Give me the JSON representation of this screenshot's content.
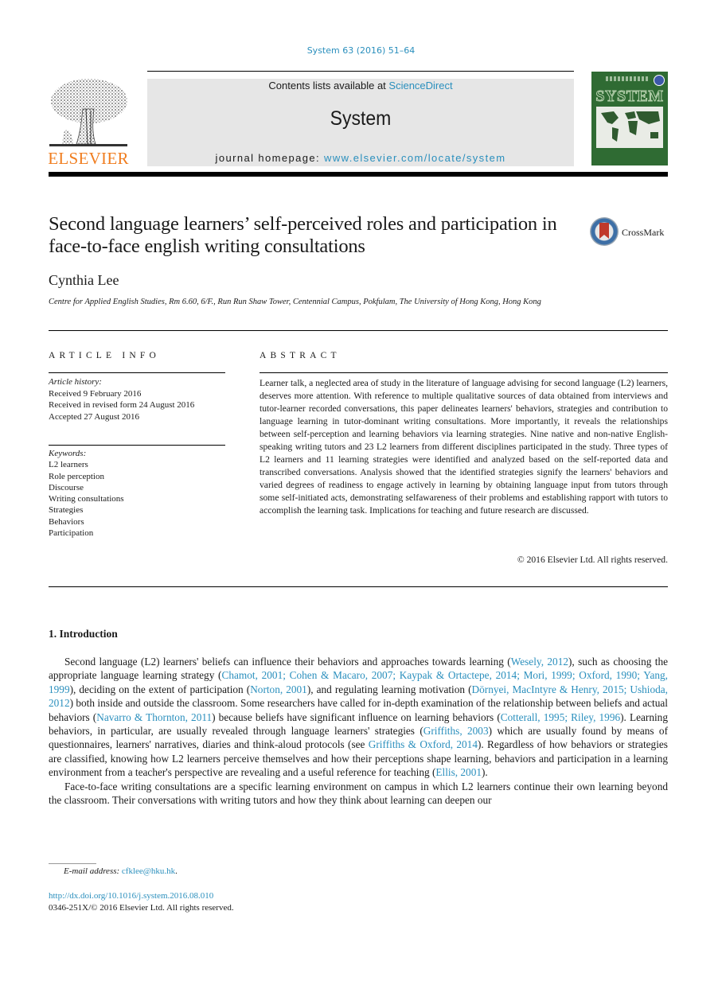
{
  "header": {
    "citation": "System 63 (2016) 51–64",
    "publisher_logo_text": "ELSEVIER",
    "contents_prefix": "Contents lists available at ",
    "contents_link": "ScienceDirect",
    "journal_name": "System",
    "homepage_prefix": "journal homepage: ",
    "homepage_link": "www.elsevier.com/locate/system",
    "cover_title": "SYSTEM",
    "brand_orange": "#f07d1f",
    "link_color": "#2a8fbd",
    "cover_green": "#2f6b33"
  },
  "article": {
    "title": "Second language learners’ self-perceived roles and participation in face-to-face english writing consultations",
    "crossmark_label": "CrossMark",
    "author": "Cynthia Lee",
    "affiliation": "Centre for Applied English Studies, Rm 6.60, 6/F., Run Run Shaw Tower, Centennial Campus, Pokfulam, The University of Hong Kong, Hong Kong"
  },
  "article_info": {
    "heading": "ARTICLE INFO",
    "history_label": "Article history:",
    "history": [
      "Received 9 February 2016",
      "Received in revised form 24 August 2016",
      "Accepted 27 August 2016"
    ],
    "keywords_label": "Keywords:",
    "keywords": [
      "L2 learners",
      "Role perception",
      "Discourse",
      "Writing consultations",
      "Strategies",
      "Behaviors",
      "Participation"
    ]
  },
  "abstract": {
    "heading": "ABSTRACT",
    "text": "Learner talk, a neglected area of study in the literature of language advising for second language (L2) learners, deserves more attention. With reference to multiple qualitative sources of data obtained from interviews and tutor-learner recorded conversations, this paper delineates learners' behaviors, strategies and contribution to language learning in tutor-dominant writing consultations. More importantly, it reveals the relationships between self-perception and learning behaviors via learning strategies. Nine native and non-native English-speaking writing tutors and 23 L2 learners from different disciplines participated in the study. Three types of L2 learners and 11 learning strategies were identified and analyzed based on the self-reported data and transcribed conversations. Analysis showed that the identified strategies signify the learners' behaviors and varied degrees of readiness to engage actively in learning by obtaining language input from tutors through some self-initiated acts, demonstrating selfawareness of their problems and establishing rapport with tutors to accomplish the learning task. Implications for teaching and future research are discussed.",
    "copyright": "© 2016 Elsevier Ltd. All rights reserved."
  },
  "intro": {
    "heading": "1.  Introduction",
    "p1": [
      {
        "t": "Second language (L2) learners' beliefs can influence their behaviors and approaches towards learning ("
      },
      {
        "t": "Wesely, 2012",
        "link": true
      },
      {
        "t": "), such as choosing the appropriate language learning strategy ("
      },
      {
        "t": "Chamot, 2001; Cohen & Macaro, 2007; Kaypak & Ortactepe, 2014; Mori, 1999; Oxford, 1990; Yang, 1999",
        "link": true
      },
      {
        "t": "), deciding on the extent of participation ("
      },
      {
        "t": "Norton, 2001",
        "link": true
      },
      {
        "t": "), and regulating learning motivation ("
      },
      {
        "t": "Dörnyei, MacIntyre & Henry, 2015; Ushioda, 2012",
        "link": true
      },
      {
        "t": ") both inside and outside the classroom. Some researchers have called for in-depth examination of the relationship between beliefs and actual behaviors ("
      },
      {
        "t": "Navarro & Thornton, 2011",
        "link": true
      },
      {
        "t": ") because beliefs have significant influence on learning behaviors ("
      },
      {
        "t": "Cotterall, 1995; Riley, 1996",
        "link": true
      },
      {
        "t": "). Learning behaviors, in particular, are usually revealed through language learners' strategies ("
      },
      {
        "t": "Griffiths, 2003",
        "link": true
      },
      {
        "t": ") which are usually found by means of questionnaires, learners' narratives, diaries and think-aloud protocols (see "
      },
      {
        "t": "Griffiths & Oxford, 2014",
        "link": true
      },
      {
        "t": "). Regardless of how behaviors or strategies are classified, knowing how L2 learners perceive themselves and how their perceptions shape learning, behaviors and participation in a learning environment from a teacher's perspective are revealing and a useful reference for teaching ("
      },
      {
        "t": "Ellis, 2001",
        "link": true
      },
      {
        "t": ")."
      }
    ],
    "p2": "Face-to-face writing consultations are a specific learning environment on campus in which L2 learners continue their own learning beyond the classroom. Their conversations with writing tutors and how they think about learning can deepen our"
  },
  "footer": {
    "email_label": "E-mail address:",
    "email": "cfklee@hku.hk",
    "email_suffix": ".",
    "doi": "http://dx.doi.org/10.1016/j.system.2016.08.010",
    "issn": "0346-251X/© 2016 Elsevier Ltd. All rights reserved."
  }
}
